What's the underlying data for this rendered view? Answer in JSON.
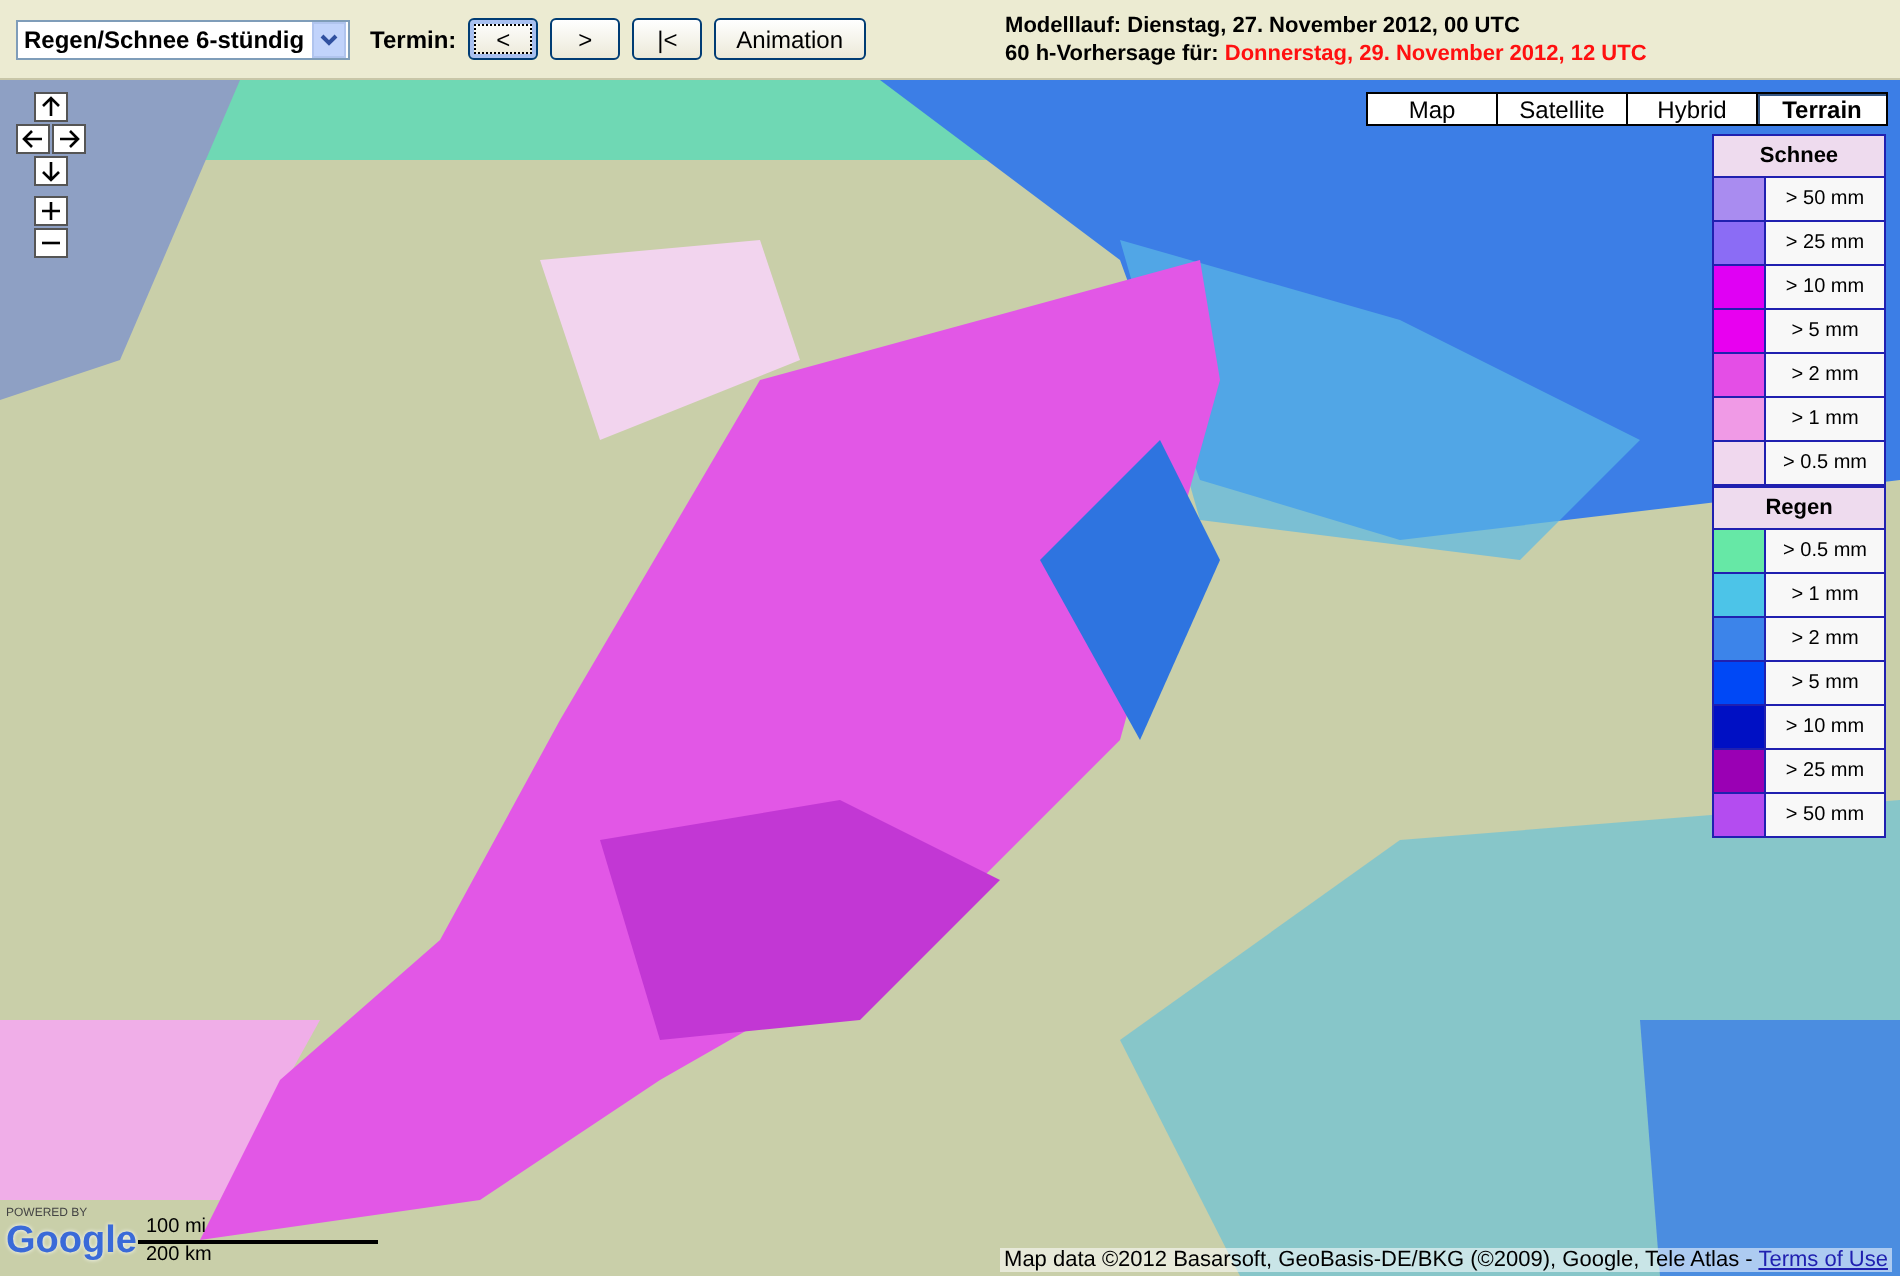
{
  "toolbar": {
    "product_select": {
      "value": "Regen/Schnee 6-stündig"
    },
    "termin_label": "Termin:",
    "buttons": [
      {
        "label": "<",
        "selected": true
      },
      {
        "label": ">",
        "selected": false
      },
      {
        "label": "|<",
        "selected": false
      },
      {
        "label": "Animation",
        "selected": false
      }
    ],
    "model_run": "Modelllauf: Dienstag, 27. November 2012, 00 UTC",
    "forecast": {
      "prefix": "60 h-Vorhersage für:",
      "date": "Donnerstag, 29. November 2012, 12 UTC"
    }
  },
  "map": {
    "map_types": [
      {
        "label": "Map",
        "selected": false
      },
      {
        "label": "Satellite",
        "selected": false
      },
      {
        "label": "Hybrid",
        "selected": false
      },
      {
        "label": "Terrain",
        "selected": true
      }
    ],
    "legend": [
      {
        "title": "Schnee",
        "items": [
          {
            "label": "> 50 mm",
            "color": "#a98cf0"
          },
          {
            "label": "> 25 mm",
            "color": "#8b6cf5"
          },
          {
            "label": "> 10 mm",
            "color": "#e000f4"
          },
          {
            "label": "> 5 mm",
            "color": "#e800f0"
          },
          {
            "label": "> 2 mm",
            "color": "#e44ee6"
          },
          {
            "label": "> 1 mm",
            "color": "#f09ae6"
          },
          {
            "label": "> 0.5 mm",
            "color": "#f0d8ee"
          }
        ]
      },
      {
        "title": "Regen",
        "items": [
          {
            "label": "> 0.5 mm",
            "color": "#66e8a6"
          },
          {
            "label": "> 1 mm",
            "color": "#4cc4e8"
          },
          {
            "label": "> 2 mm",
            "color": "#3c84ea"
          },
          {
            "label": "> 5 mm",
            "color": "#0048f6"
          },
          {
            "label": "> 10 mm",
            "color": "#0010c4"
          },
          {
            "label": "> 25 mm",
            "color": "#9a00b4"
          },
          {
            "label": "> 50 mm",
            "color": "#b44cf0"
          }
        ]
      }
    ],
    "logo": {
      "caption": "POWERED BY",
      "name": "Google"
    },
    "scale": {
      "imperial": "100 mi",
      "metric": "200 km"
    },
    "attribution": {
      "text": "Map data ©2012 Basarsoft, GeoBasis-DE/BKG (©2009), Google, Tele Atlas -",
      "link": "Terms of Use"
    }
  }
}
